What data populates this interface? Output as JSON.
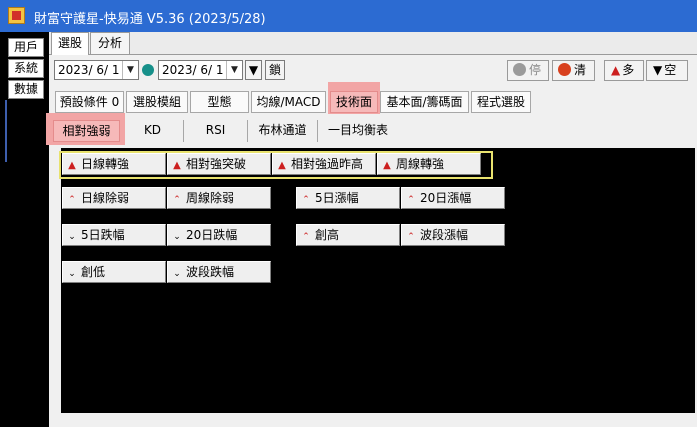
{
  "window": {
    "title": "財富守護星-快易通 V5.36 (2023/5/28)"
  },
  "side_menu": [
    {
      "label": "用戶"
    },
    {
      "label": "系統"
    },
    {
      "label": "數據"
    }
  ],
  "tabs": [
    {
      "label": "選股",
      "active": true
    },
    {
      "label": "分析",
      "active": false
    }
  ],
  "date_range": {
    "start": "2023/ 6/ 1",
    "end": "2023/ 6/ 1",
    "lock_label": "鎖"
  },
  "controls": {
    "stop_label": "停",
    "clear_label": "清",
    "long_label": "多",
    "short_label": "空"
  },
  "categories": [
    {
      "label": "預設條件 0"
    },
    {
      "label": "選股模組"
    },
    {
      "label": "型態"
    },
    {
      "label": "均線/MACD"
    },
    {
      "label": "技術面",
      "active": true
    },
    {
      "label": "基本面/籌碼面"
    },
    {
      "label": "程式選股"
    }
  ],
  "subtabs": [
    {
      "label": "相對強弱",
      "active": true
    },
    {
      "label": "KD"
    },
    {
      "label": "RSI"
    },
    {
      "label": "布林通道"
    },
    {
      "label": "一目均衡表"
    }
  ],
  "strategy_buttons": [
    {
      "label": "日線轉強",
      "icon": "triangle-up-icon"
    },
    {
      "label": "相對強突破",
      "icon": "triangle-up-icon"
    },
    {
      "label": "相對強過昨高",
      "icon": "triangle-up-icon"
    },
    {
      "label": "周線轉強",
      "icon": "triangle-up-icon"
    },
    {
      "label": "日線除弱",
      "icon": "caret-up-icon"
    },
    {
      "label": "周線除弱",
      "icon": "caret-up-icon"
    },
    {
      "label": "5日漲幅",
      "icon": "caret-up-icon"
    },
    {
      "label": "20日漲幅",
      "icon": "caret-up-icon"
    },
    {
      "label": "5日跌幅",
      "icon": "caret-down-icon"
    },
    {
      "label": "20日跌幅",
      "icon": "caret-down-icon"
    },
    {
      "label": "創高",
      "icon": "caret-up-icon"
    },
    {
      "label": "波段漲幅",
      "icon": "caret-up-icon"
    },
    {
      "label": "創低",
      "icon": "caret-down-icon"
    },
    {
      "label": "波段跌幅",
      "icon": "caret-down-icon"
    }
  ],
  "colors": {
    "titlebar": "#2c6bd2",
    "highlight": "#f2a5a5",
    "selection_frame": "#e8e26e",
    "up_arrow": "#cc1f1f",
    "status_dot": "#17908a"
  }
}
